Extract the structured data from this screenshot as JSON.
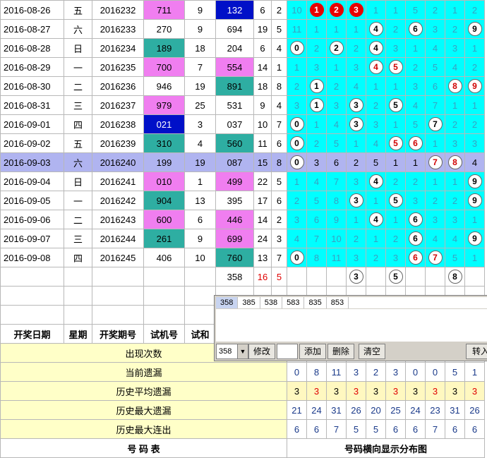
{
  "rows": [
    {
      "date": "2016-08-26",
      "wk": "五",
      "issue": "2016232",
      "test": "711",
      "testc": "mag",
      "sum": "9",
      "draw": "132",
      "drawc": "blue",
      "span": "6",
      "v": "2",
      "d": [
        {
          "t": "10"
        },
        {
          "t": "1",
          "b": "red"
        },
        {
          "t": "2",
          "b": "red"
        },
        {
          "t": "3",
          "b": "red"
        },
        {
          "t": "1"
        },
        {
          "t": "1"
        },
        {
          "t": "5"
        },
        {
          "t": "2"
        },
        {
          "t": "1"
        },
        {
          "t": "2"
        }
      ]
    },
    {
      "date": "2016-08-27",
      "wk": "六",
      "issue": "2016233",
      "test": "270",
      "testc": "",
      "sum": "9",
      "draw": "694",
      "drawc": "",
      "span": "19",
      "v": "5",
      "d": [
        {
          "t": "11"
        },
        {
          "t": "1"
        },
        {
          "t": "1"
        },
        {
          "t": "1"
        },
        {
          "t": "4",
          "b": "wk"
        },
        {
          "t": "2"
        },
        {
          "t": "6",
          "b": "wk"
        },
        {
          "t": "3"
        },
        {
          "t": "2"
        },
        {
          "t": "9",
          "b": "wk"
        }
      ]
    },
    {
      "date": "2016-08-28",
      "wk": "日",
      "issue": "2016234",
      "test": "189",
      "testc": "teal",
      "sum": "18",
      "draw": "204",
      "drawc": "",
      "span": "6",
      "v": "4",
      "d": [
        {
          "t": "0",
          "b": "wk"
        },
        {
          "t": "2"
        },
        {
          "t": "2",
          "b": "wk"
        },
        {
          "t": "2"
        },
        {
          "t": "4",
          "b": "wk"
        },
        {
          "t": "3"
        },
        {
          "t": "1"
        },
        {
          "t": "4"
        },
        {
          "t": "3"
        },
        {
          "t": "1"
        }
      ]
    },
    {
      "date": "2016-08-29",
      "wk": "一",
      "issue": "2016235",
      "test": "700",
      "testc": "mag",
      "sum": "7",
      "draw": "554",
      "drawc": "mag",
      "span": "14",
      "v": "1",
      "d": [
        {
          "t": "1"
        },
        {
          "t": "3"
        },
        {
          "t": "1"
        },
        {
          "t": "3"
        },
        {
          "t": "4",
          "b": "wr"
        },
        {
          "t": "5",
          "b": "wr"
        },
        {
          "t": "2"
        },
        {
          "t": "5"
        },
        {
          "t": "4"
        },
        {
          "t": "2"
        }
      ]
    },
    {
      "date": "2016-08-30",
      "wk": "二",
      "issue": "2016236",
      "test": "946",
      "testc": "",
      "sum": "19",
      "draw": "891",
      "drawc": "teal",
      "span": "18",
      "v": "8",
      "d": [
        {
          "t": "2"
        },
        {
          "t": "1",
          "b": "wk"
        },
        {
          "t": "2"
        },
        {
          "t": "4"
        },
        {
          "t": "1"
        },
        {
          "t": "1"
        },
        {
          "t": "3"
        },
        {
          "t": "6"
        },
        {
          "t": "8",
          "b": "wr"
        },
        {
          "t": "9",
          "b": "wr"
        }
      ]
    },
    {
      "date": "2016-08-31",
      "wk": "三",
      "issue": "2016237",
      "test": "979",
      "testc": "mag",
      "sum": "25",
      "draw": "531",
      "drawc": "",
      "span": "9",
      "v": "4",
      "d": [
        {
          "t": "3"
        },
        {
          "t": "1",
          "b": "wk"
        },
        {
          "t": "3"
        },
        {
          "t": "3",
          "b": "wk"
        },
        {
          "t": "2"
        },
        {
          "t": "5",
          "b": "wk"
        },
        {
          "t": "4"
        },
        {
          "t": "7"
        },
        {
          "t": "1"
        },
        {
          "t": "1"
        }
      ]
    },
    {
      "date": "2016-09-01",
      "wk": "四",
      "issue": "2016238",
      "test": "021",
      "testc": "blue",
      "sum": "3",
      "draw": "037",
      "drawc": "",
      "span": "10",
      "v": "7",
      "d": [
        {
          "t": "0",
          "b": "wk"
        },
        {
          "t": "1"
        },
        {
          "t": "4"
        },
        {
          "t": "3",
          "b": "wk"
        },
        {
          "t": "3"
        },
        {
          "t": "1"
        },
        {
          "t": "5"
        },
        {
          "t": "7",
          "b": "wk"
        },
        {
          "t": "2"
        },
        {
          "t": "2"
        }
      ]
    },
    {
      "date": "2016-09-02",
      "wk": "五",
      "issue": "2016239",
      "test": "310",
      "testc": "teal",
      "sum": "4",
      "draw": "560",
      "drawc": "teal",
      "span": "11",
      "v": "6",
      "d": [
        {
          "t": "0",
          "b": "wk"
        },
        {
          "t": "2"
        },
        {
          "t": "5"
        },
        {
          "t": "1"
        },
        {
          "t": "4"
        },
        {
          "t": "5",
          "b": "wr"
        },
        {
          "t": "6",
          "b": "wr"
        },
        {
          "t": "1"
        },
        {
          "t": "3"
        },
        {
          "t": "3"
        }
      ]
    },
    {
      "date": "2016-09-03",
      "wk": "六",
      "issue": "2016240",
      "test": "199",
      "testc": "mag",
      "sum": "19",
      "draw": "087",
      "drawc": "teal",
      "span": "15",
      "v": "8",
      "hl": true,
      "d": [
        {
          "t": "0",
          "b": "wk"
        },
        {
          "t": "3"
        },
        {
          "t": "6"
        },
        {
          "t": "2"
        },
        {
          "t": "5"
        },
        {
          "t": "1"
        },
        {
          "t": "1"
        },
        {
          "t": "7",
          "b": "wr"
        },
        {
          "t": "8",
          "b": "wr"
        },
        {
          "t": "4"
        }
      ]
    },
    {
      "date": "2016-09-04",
      "wk": "日",
      "issue": "2016241",
      "test": "010",
      "testc": "mag",
      "sum": "1",
      "draw": "499",
      "drawc": "mag",
      "span": "22",
      "v": "5",
      "d": [
        {
          "t": "1"
        },
        {
          "t": "4"
        },
        {
          "t": "7"
        },
        {
          "t": "3"
        },
        {
          "t": "4",
          "b": "wk"
        },
        {
          "t": "2"
        },
        {
          "t": "2"
        },
        {
          "t": "1"
        },
        {
          "t": "1"
        },
        {
          "t": "9",
          "b": "wk"
        }
      ]
    },
    {
      "date": "2016-09-05",
      "wk": "一",
      "issue": "2016242",
      "test": "904",
      "testc": "teal",
      "sum": "13",
      "draw": "395",
      "drawc": "",
      "span": "17",
      "v": "6",
      "d": [
        {
          "t": "2"
        },
        {
          "t": "5"
        },
        {
          "t": "8"
        },
        {
          "t": "3",
          "b": "wk"
        },
        {
          "t": "1"
        },
        {
          "t": "5",
          "b": "wk"
        },
        {
          "t": "3"
        },
        {
          "t": "2"
        },
        {
          "t": "2"
        },
        {
          "t": "9",
          "b": "wk"
        }
      ]
    },
    {
      "date": "2016-09-06",
      "wk": "二",
      "issue": "2016243",
      "test": "600",
      "testc": "mag",
      "sum": "6",
      "draw": "446",
      "drawc": "mag",
      "span": "14",
      "v": "2",
      "d": [
        {
          "t": "3"
        },
        {
          "t": "6"
        },
        {
          "t": "9"
        },
        {
          "t": "1"
        },
        {
          "t": "4",
          "b": "wk"
        },
        {
          "t": "1"
        },
        {
          "t": "6",
          "b": "wk"
        },
        {
          "t": "3"
        },
        {
          "t": "3"
        },
        {
          "t": "1"
        }
      ]
    },
    {
      "date": "2016-09-07",
      "wk": "三",
      "issue": "2016244",
      "test": "261",
      "testc": "teal",
      "sum": "9",
      "draw": "699",
      "drawc": "mag",
      "span": "24",
      "v": "3",
      "d": [
        {
          "t": "4"
        },
        {
          "t": "7"
        },
        {
          "t": "10"
        },
        {
          "t": "2"
        },
        {
          "t": "1"
        },
        {
          "t": "2"
        },
        {
          "t": "6",
          "b": "wk"
        },
        {
          "t": "4"
        },
        {
          "t": "4"
        },
        {
          "t": "9",
          "b": "wk"
        }
      ]
    },
    {
      "date": "2016-09-08",
      "wk": "四",
      "issue": "2016245",
      "test": "406",
      "testc": "",
      "sum": "10",
      "draw": "760",
      "drawc": "teal",
      "span": "13",
      "v": "7",
      "d": [
        {
          "t": "0",
          "b": "wk"
        },
        {
          "t": "8"
        },
        {
          "t": "11"
        },
        {
          "t": "3"
        },
        {
          "t": "2"
        },
        {
          "t": "3"
        },
        {
          "t": "6",
          "b": "wr"
        },
        {
          "t": "7",
          "b": "wr"
        },
        {
          "t": "5"
        },
        {
          "t": "1"
        }
      ]
    }
  ],
  "next": {
    "draw": "358",
    "span": "16",
    "v": "5",
    "balls": [
      "",
      "",
      "",
      "3",
      "",
      "5",
      "",
      "",
      "8",
      ""
    ]
  },
  "headers": {
    "date": "开奖日期",
    "wk": "星期",
    "issue": "开奖期号",
    "test": "试机号",
    "sum": "试和"
  },
  "stats": [
    {
      "label": "出现次数",
      "vals": [
        "",
        "",
        "",
        "",
        "",
        "",
        "",
        "",
        "",
        ""
      ]
    },
    {
      "label": "当前遗漏",
      "vals": [
        "0",
        "8",
        "11",
        "3",
        "2",
        "3",
        "0",
        "0",
        "5",
        "1"
      ]
    },
    {
      "label": "历史平均遗漏",
      "vals": [
        "3",
        "3",
        "3",
        "3",
        "3",
        "3",
        "3",
        "3",
        "3",
        "3"
      ]
    },
    {
      "label": "历史最大遗漏",
      "vals": [
        "21",
        "24",
        "31",
        "26",
        "20",
        "25",
        "24",
        "23",
        "31",
        "26"
      ]
    },
    {
      "label": "历史最大连出",
      "vals": [
        "6",
        "6",
        "7",
        "5",
        "5",
        "6",
        "6",
        "7",
        "6",
        "6"
      ]
    }
  ],
  "footer": {
    "left": "号 码 表",
    "right": "号码横向显示分布图"
  },
  "dialog": {
    "tabs": [
      "358",
      "385",
      "538",
      "583",
      "835",
      "853"
    ],
    "select": "358",
    "buttons": {
      "edit": "修改",
      "add": "添加",
      "del": "删除",
      "clear": "清空",
      "transfer": "转入"
    }
  }
}
